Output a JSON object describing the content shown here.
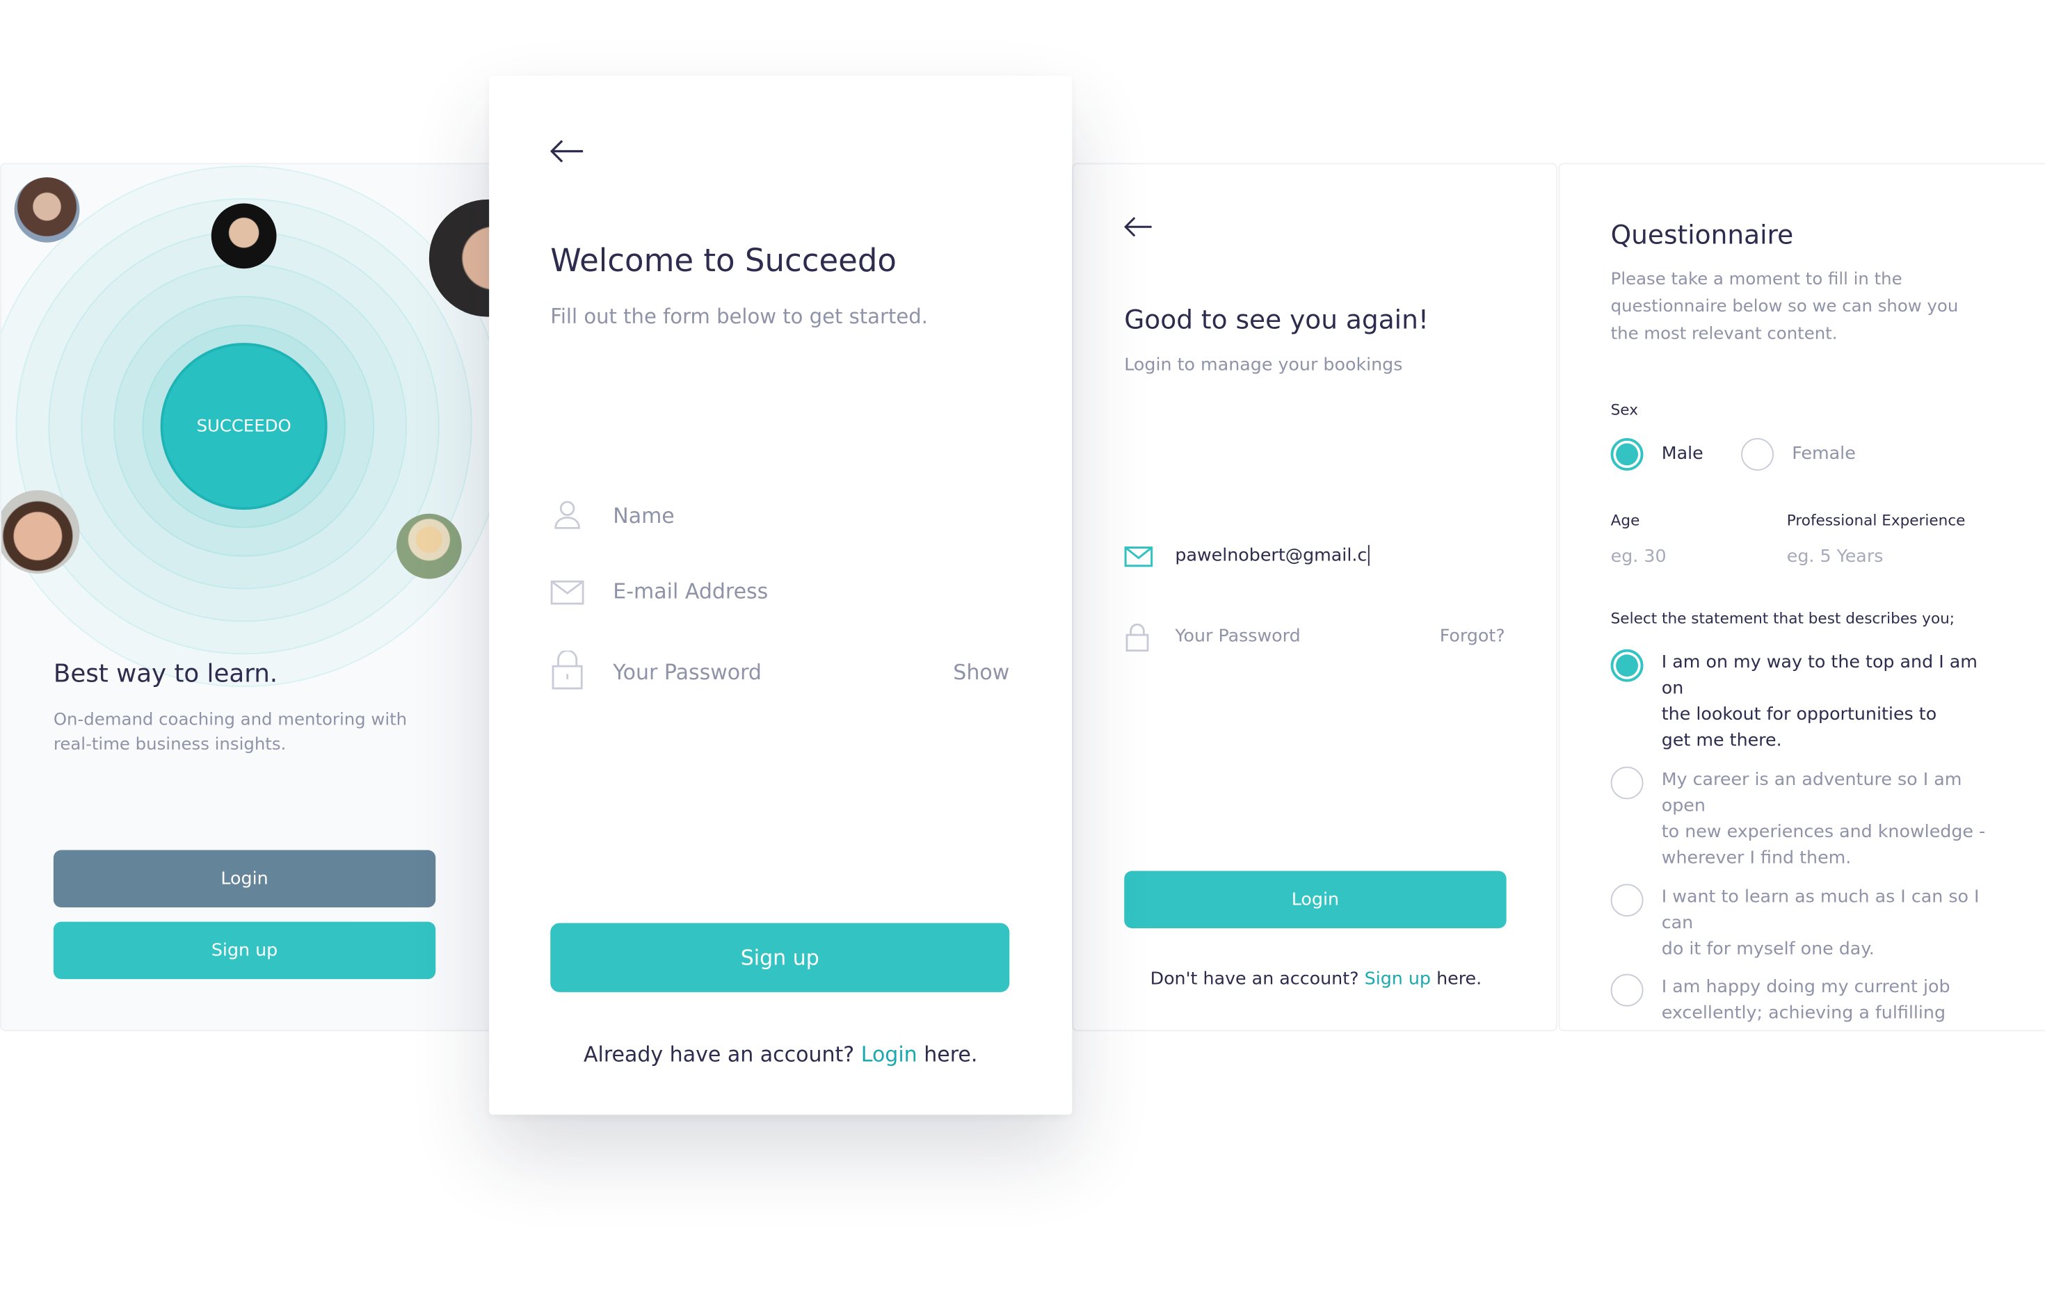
{
  "colors": {
    "accent": "#33c3c3",
    "login_button": "#64849a",
    "text": "#2e2c4e",
    "muted": "#8f93a8"
  },
  "splash": {
    "logo": "SUCCEEDO",
    "title": "Best way to learn.",
    "subtitle_lines": [
      "On-demand coaching and mentoring with",
      "real-time business insights."
    ],
    "login_label": "Login",
    "signup_label": "Sign up"
  },
  "signup": {
    "back_icon": "arrow-left-icon",
    "title": "Welcome to Succeedo",
    "subtitle": "Fill out the form below to get started.",
    "name_placeholder": "Name",
    "email_placeholder": "E-mail Address",
    "password_placeholder": "Your Password",
    "show_label": "Show",
    "submit_label": "Sign up",
    "footer_prefix": "Already have an account?",
    "footer_link": "Login",
    "footer_suffix": "here."
  },
  "login": {
    "back_icon": "arrow-left-icon",
    "title": "Good to see you again!",
    "subtitle": "Login to manage your bookings",
    "email_value": "pawelnobert@gmail.c",
    "password_placeholder": "Your Password",
    "forgot_label": "Forgot?",
    "submit_label": "Login",
    "footer_prefix": "Don't have an account?",
    "footer_link": "Sign up",
    "footer_suffix": "here."
  },
  "questionnaire": {
    "title": "Questionnaire",
    "description_lines": [
      "Please take a moment to fill in the",
      "questionnaire below so we can show you",
      "the most relevant content."
    ],
    "sex_label": "Sex",
    "sex_options": [
      {
        "label": "Male",
        "selected": true
      },
      {
        "label": "Female",
        "selected": false
      }
    ],
    "age_label": "Age",
    "age_placeholder": "eg. 30",
    "experience_label": "Professional Experience",
    "experience_placeholder": "eg. 5 Years",
    "statement_label": "Select the statement that best describes you;",
    "statements": [
      {
        "lines": [
          "I am on my way to the top and I am on",
          "the lookout for opportunities to",
          "get me there."
        ],
        "selected": true
      },
      {
        "lines": [
          "My career is an adventure so I am open",
          "to new experiences and knowledge -",
          "wherever I find them."
        ],
        "selected": false
      },
      {
        "lines": [
          "I want to learn as much as I can so I can",
          "do it for myself one day."
        ],
        "selected": false
      },
      {
        "lines": [
          "I am happy doing my current job",
          "excellently; achieving a fulfilling"
        ],
        "selected": false
      }
    ]
  }
}
